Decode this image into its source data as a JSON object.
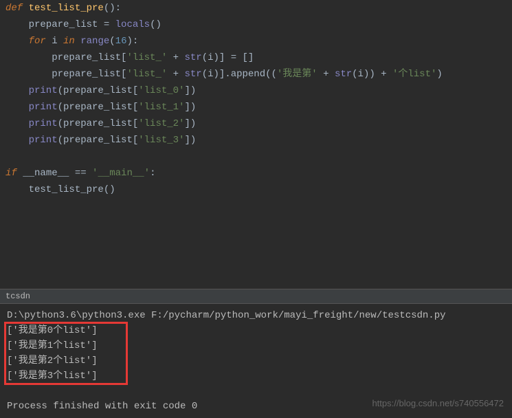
{
  "code": {
    "l1_def": "def",
    "l1_name": " test_list_pre",
    "l1_rest": "():",
    "l2_var": "    prepare_list ",
    "l2_op": "= ",
    "l2_builtin": "locals",
    "l2_paren": "()",
    "l3_for": "    for",
    "l3_i": " i ",
    "l3_in": "in",
    "l3_sp": " ",
    "l3_range": "range",
    "l3_open": "(",
    "l3_num": "16",
    "l3_close": "):",
    "l4_pre": "        prepare_list[",
    "l4_str": "'list_'",
    "l4_plus": " + ",
    "l4_str2": "str",
    "l4_p1": "(i)] ",
    "l4_eq": "= ",
    "l4_empty": "[]",
    "l5_pre": "        prepare_list[",
    "l5_str": "'list_'",
    "l5_plus": " + ",
    "l5_str2": "str",
    "l5_p1": "(i)].append((",
    "l5_s2": "'我是第'",
    "l5_plus2": " + ",
    "l5_str3": "str",
    "l5_p2": "(i)) + ",
    "l5_s3": "'个list'",
    "l5_close": ")",
    "l6_print": "    print",
    "l6_arg": "(prepare_list[",
    "l6_str": "'list_0'",
    "l6_end": "])",
    "l7_print": "    print",
    "l7_arg": "(prepare_list[",
    "l7_str": "'list_1'",
    "l7_end": "])",
    "l8_print": "    print",
    "l8_arg": "(prepare_list[",
    "l8_str": "'list_2'",
    "l8_end": "])",
    "l9_print": "    print",
    "l9_arg": "(prepare_list[",
    "l9_str": "'list_3'",
    "l9_end": "])",
    "l10_if": "if",
    "l10_name": " __name__ ",
    "l10_eq": "== ",
    "l10_main": "'__main__'",
    "l10_colon": ":",
    "l11_call": "    test_list_pre()"
  },
  "console": {
    "tab": "tcsdn",
    "cmd": "D:\\python3.6\\python3.exe F:/pycharm/python_work/mayi_freight/new/testcsdn.py",
    "out1": "['我是第0个list']",
    "out2": "['我是第1个list']",
    "out3": "['我是第2个list']",
    "out4": "['我是第3个list']",
    "exit": "Process finished with exit code 0"
  },
  "watermark": "https://blog.csdn.net/s740556472"
}
